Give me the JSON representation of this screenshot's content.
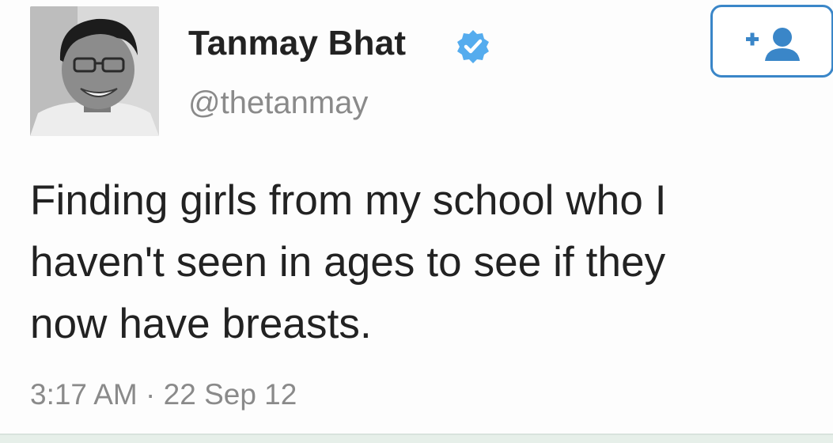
{
  "tweet": {
    "author": {
      "display_name": "Tanmay Bhat",
      "handle": "@thetanmay",
      "verified": true,
      "avatar_icon": "profile-photo"
    },
    "follow_button": {
      "icon": "add-user-icon",
      "accent_color": "#3a86c8"
    },
    "text_lines": [
      "Finding girls from my school who I",
      "haven't seen in ages to see if they",
      "now have breasts."
    ],
    "timestamp": "3:17 AM · 22 Sep 12"
  },
  "colors": {
    "text": "#222222",
    "secondary_text": "#8a8a8a",
    "verified_badge": "#55acee",
    "follow_border": "#3a86c8"
  }
}
